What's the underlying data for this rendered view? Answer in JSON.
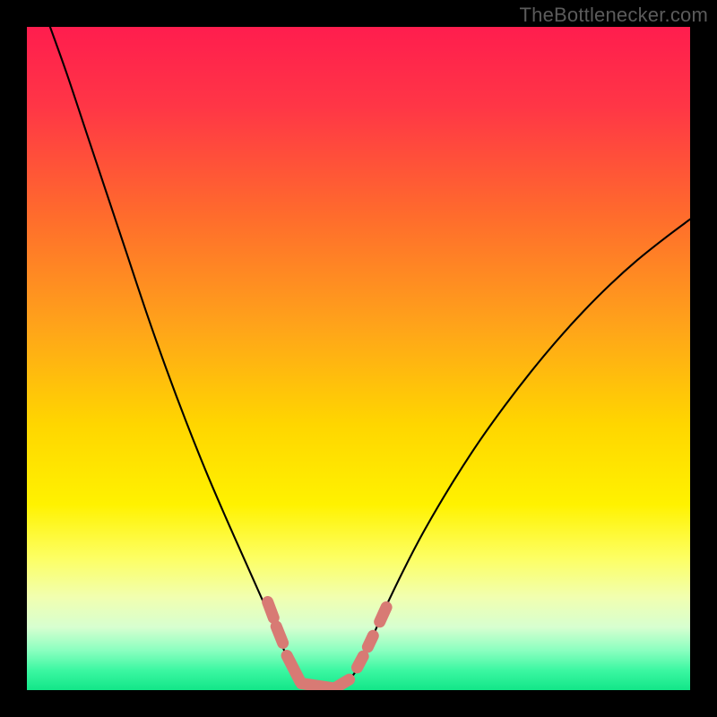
{
  "watermark": "TheBottlenecker.com",
  "chart_data": {
    "type": "line",
    "title": "",
    "xlabel": "",
    "ylabel": "",
    "xlim": [
      0,
      100
    ],
    "ylim": [
      0,
      100
    ],
    "grid": false,
    "legend": false,
    "background_gradient_stops": [
      {
        "offset": 0.0,
        "color": "#ff1d4e"
      },
      {
        "offset": 0.12,
        "color": "#ff3646"
      },
      {
        "offset": 0.28,
        "color": "#ff6a2d"
      },
      {
        "offset": 0.45,
        "color": "#ffa31a"
      },
      {
        "offset": 0.6,
        "color": "#ffd600"
      },
      {
        "offset": 0.72,
        "color": "#fff200"
      },
      {
        "offset": 0.8,
        "color": "#fdff62"
      },
      {
        "offset": 0.86,
        "color": "#f1ffb0"
      },
      {
        "offset": 0.905,
        "color": "#d7ffd0"
      },
      {
        "offset": 0.94,
        "color": "#8bffc0"
      },
      {
        "offset": 0.97,
        "color": "#3cf7a2"
      },
      {
        "offset": 1.0,
        "color": "#12e688"
      }
    ],
    "series": [
      {
        "name": "left-branch",
        "stroke": "#000000",
        "stroke_width": 2.1,
        "points": [
          {
            "x": 3.5,
            "y": 100.0
          },
          {
            "x": 6.0,
            "y": 93.0
          },
          {
            "x": 9.0,
            "y": 84.0
          },
          {
            "x": 12.0,
            "y": 75.0
          },
          {
            "x": 15.0,
            "y": 66.0
          },
          {
            "x": 18.0,
            "y": 57.0
          },
          {
            "x": 21.0,
            "y": 48.5
          },
          {
            "x": 24.0,
            "y": 40.5
          },
          {
            "x": 27.0,
            "y": 33.0
          },
          {
            "x": 30.0,
            "y": 26.0
          },
          {
            "x": 32.0,
            "y": 21.5
          },
          {
            "x": 34.0,
            "y": 17.0
          },
          {
            "x": 36.0,
            "y": 12.5
          },
          {
            "x": 37.5,
            "y": 9.0
          },
          {
            "x": 39.0,
            "y": 5.5
          },
          {
            "x": 40.0,
            "y": 3.0
          },
          {
            "x": 41.0,
            "y": 1.2
          },
          {
            "x": 42.0,
            "y": 0.4
          },
          {
            "x": 43.5,
            "y": 0.0
          }
        ]
      },
      {
        "name": "right-branch",
        "stroke": "#000000",
        "stroke_width": 2.1,
        "points": [
          {
            "x": 46.5,
            "y": 0.0
          },
          {
            "x": 48.0,
            "y": 0.8
          },
          {
            "x": 49.0,
            "y": 2.0
          },
          {
            "x": 50.0,
            "y": 3.6
          },
          {
            "x": 52.0,
            "y": 7.8
          },
          {
            "x": 54.0,
            "y": 12.3
          },
          {
            "x": 57.0,
            "y": 18.5
          },
          {
            "x": 60.0,
            "y": 24.2
          },
          {
            "x": 64.0,
            "y": 31.0
          },
          {
            "x": 68.0,
            "y": 37.2
          },
          {
            "x": 72.0,
            "y": 42.8
          },
          {
            "x": 76.0,
            "y": 48.0
          },
          {
            "x": 80.0,
            "y": 52.8
          },
          {
            "x": 84.0,
            "y": 57.2
          },
          {
            "x": 88.0,
            "y": 61.2
          },
          {
            "x": 92.0,
            "y": 64.8
          },
          {
            "x": 96.0,
            "y": 68.0
          },
          {
            "x": 100.0,
            "y": 71.0
          }
        ]
      },
      {
        "name": "markers",
        "type": "scatter-segments",
        "stroke": "#d87a74",
        "stroke_width": 13,
        "linecap": "round",
        "segments": [
          {
            "x1": 36.3,
            "y1": 13.3,
            "x2": 37.2,
            "y2": 10.9
          },
          {
            "x1": 37.6,
            "y1": 9.6,
            "x2": 38.6,
            "y2": 7.1
          },
          {
            "x1": 39.2,
            "y1": 5.2,
            "x2": 41.2,
            "y2": 1.3
          },
          {
            "x1": 41.4,
            "y1": 1.0,
            "x2": 46.2,
            "y2": 0.3
          },
          {
            "x1": 46.6,
            "y1": 0.4,
            "x2": 48.6,
            "y2": 1.6
          },
          {
            "x1": 49.8,
            "y1": 3.4,
            "x2": 50.7,
            "y2": 5.1
          },
          {
            "x1": 51.4,
            "y1": 6.5,
            "x2": 52.2,
            "y2": 8.2
          },
          {
            "x1": 53.2,
            "y1": 10.3,
            "x2": 54.2,
            "y2": 12.5
          }
        ]
      }
    ]
  }
}
